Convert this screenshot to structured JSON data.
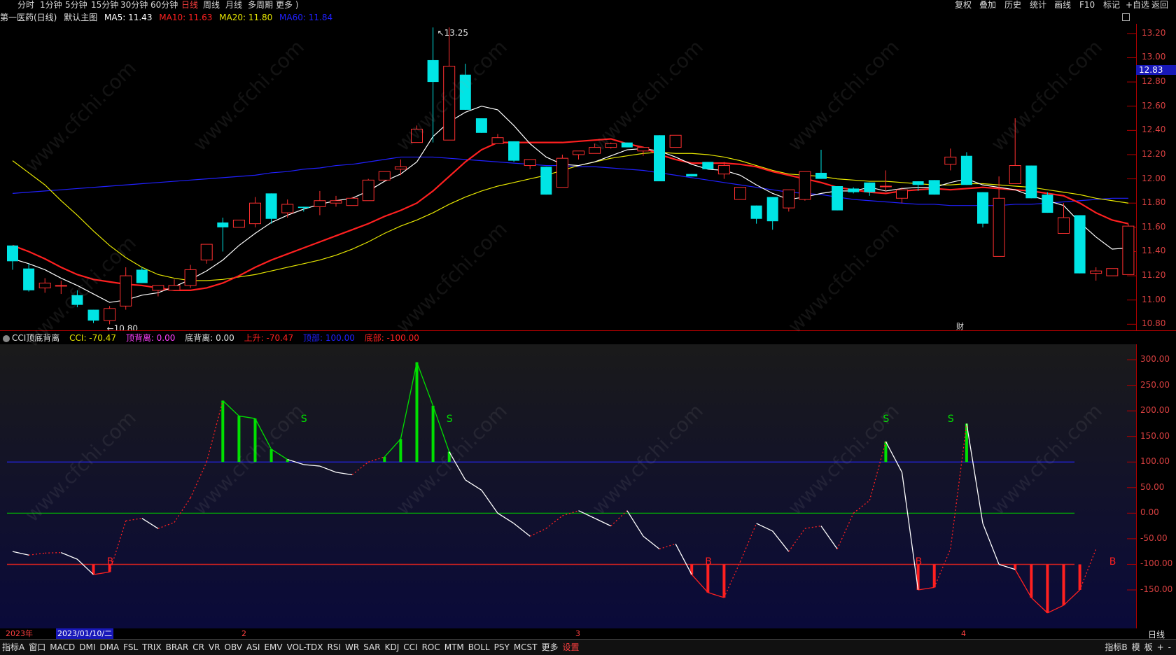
{
  "toolbar_left": [
    "分时",
    "1分钟",
    "5分钟",
    "15分钟",
    "30分钟",
    "60分钟",
    "日线",
    "周线",
    "月线",
    "多周期",
    "更多 )"
  ],
  "toolbar_active": "日线",
  "toolbar_right": [
    "复权",
    "叠加",
    "历史",
    "统计",
    "画线",
    "F10",
    "标记",
    "+自选",
    "返回"
  ],
  "main_info": {
    "stock": "第一医药(日线)",
    "mode": "默认主图",
    "ma5": "MA5: 11.43",
    "ma10": "MA10: 11.63",
    "ma20": "MA20: 11.80",
    "ma60": "MA60: 11.84"
  },
  "price_axis": [
    "13.20",
    "13.00",
    "12.80",
    "12.60",
    "12.40",
    "12.20",
    "12.00",
    "11.80",
    "11.60",
    "11.40",
    "11.20",
    "11.00",
    "10.80"
  ],
  "current_price": "12.83",
  "high_label": "13.25",
  "low_label": "10.80",
  "cai_marker": "财",
  "cci_info": {
    "name": "CCI顶底背离",
    "cci": "CCI: -70.47",
    "top_div": "顶背离: 0.00",
    "bottom_div": "底背离: 0.00",
    "rise": "上升: -70.47",
    "top": "顶部: 100.00",
    "bottom": "底部: -100.00"
  },
  "cci_axis": [
    "300.00",
    "250.00",
    "200.00",
    "150.00",
    "100.00",
    "50.00",
    "0.00",
    "-50.00",
    "-100.00",
    "-150.00"
  ],
  "signals": {
    "sell": "S",
    "buy": "B"
  },
  "dates": {
    "year": "2023年",
    "cursor": "2023/01/10/二",
    "m2": "2",
    "m3": "3",
    "m4": "4"
  },
  "period_label": "日线",
  "bottom_tabs": [
    "指标A",
    "窗口",
    "MACD",
    "DMI",
    "DMA",
    "FSL",
    "TRIX",
    "BRAR",
    "CR",
    "VR",
    "OBV",
    "ASI",
    "EMV",
    "VOL-TDX",
    "RSI",
    "WR",
    "SAR",
    "KDJ",
    "CCI",
    "ROC",
    "MTM",
    "BOLL",
    "PSY",
    "MCST",
    "更多",
    "设置"
  ],
  "bottom_right": [
    "指标B",
    "模",
    "板",
    "+",
    "-"
  ],
  "watermark": "www.cfchi.com",
  "colors": {
    "up": "#ff3030",
    "down": "#00e5e5",
    "ma5": "#ffffff",
    "ma10": "#ff2020",
    "ma20": "#e6e600",
    "ma60": "#2020ff",
    "cci_up": "#00e000",
    "cci_down": "#ff2020"
  },
  "chart_data": {
    "type": "candlestick",
    "ohlc": [
      [
        11.45,
        11.45,
        11.25,
        11.32
      ],
      [
        11.26,
        11.3,
        11.07,
        11.08
      ],
      [
        11.1,
        11.18,
        11.06,
        11.14
      ],
      [
        11.12,
        11.16,
        11.05,
        11.12
      ],
      [
        11.04,
        11.08,
        10.94,
        10.96
      ],
      [
        10.92,
        10.92,
        10.81,
        10.83
      ],
      [
        10.83,
        10.95,
        10.8,
        10.93
      ],
      [
        10.95,
        11.27,
        10.92,
        11.2
      ],
      [
        11.25,
        11.27,
        11.14,
        11.14
      ],
      [
        11.08,
        11.12,
        11.03,
        11.12
      ],
      [
        11.08,
        11.17,
        11.08,
        11.12
      ],
      [
        11.12,
        11.29,
        11.1,
        11.25
      ],
      [
        11.33,
        11.46,
        11.3,
        11.46
      ],
      [
        11.64,
        11.68,
        11.4,
        11.6
      ],
      [
        11.6,
        11.66,
        11.6,
        11.66
      ],
      [
        11.63,
        11.85,
        11.6,
        11.8
      ],
      [
        11.88,
        11.88,
        11.63,
        11.67
      ],
      [
        11.72,
        11.83,
        11.68,
        11.79
      ],
      [
        11.77,
        11.77,
        11.73,
        11.76
      ],
      [
        11.77,
        11.9,
        11.7,
        11.82
      ],
      [
        11.8,
        11.86,
        11.77,
        11.82
      ],
      [
        11.78,
        11.85,
        11.78,
        11.84
      ],
      [
        11.82,
        12.0,
        11.82,
        11.99
      ],
      [
        11.99,
        12.06,
        11.99,
        12.06
      ],
      [
        12.08,
        12.16,
        12.03,
        12.1
      ],
      [
        12.3,
        12.44,
        12.3,
        12.41
      ],
      [
        12.98,
        13.25,
        12.3,
        12.8
      ],
      [
        12.32,
        13.25,
        12.32,
        12.93
      ],
      [
        12.86,
        12.95,
        12.57,
        12.57
      ],
      [
        12.5,
        12.5,
        12.38,
        12.38
      ],
      [
        12.29,
        12.37,
        12.29,
        12.34
      ],
      [
        12.31,
        12.31,
        12.14,
        12.15
      ],
      [
        12.11,
        12.16,
        12.08,
        12.16
      ],
      [
        12.1,
        12.1,
        11.87,
        11.87
      ],
      [
        11.93,
        12.2,
        11.93,
        12.17
      ],
      [
        12.2,
        12.23,
        12.16,
        12.23
      ],
      [
        12.21,
        12.29,
        12.21,
        12.26
      ],
      [
        12.26,
        12.3,
        12.25,
        12.29
      ],
      [
        12.3,
        12.3,
        12.26,
        12.26
      ],
      [
        12.23,
        12.26,
        12.19,
        12.26
      ],
      [
        12.36,
        12.36,
        11.98,
        11.98
      ],
      [
        12.26,
        12.36,
        12.26,
        12.36
      ],
      [
        12.04,
        12.04,
        12.02,
        12.02
      ],
      [
        12.14,
        12.14,
        12.08,
        12.08
      ],
      [
        12.04,
        12.14,
        12.0,
        12.11
      ],
      [
        11.83,
        11.93,
        11.83,
        11.93
      ],
      [
        11.78,
        11.78,
        11.63,
        11.67
      ],
      [
        11.85,
        11.85,
        11.58,
        11.65
      ],
      [
        11.76,
        11.91,
        11.73,
        11.91
      ],
      [
        11.83,
        12.06,
        11.82,
        12.06
      ],
      [
        12.05,
        12.24,
        12.0,
        12.0
      ],
      [
        11.94,
        11.94,
        11.74,
        11.74
      ],
      [
        11.92,
        11.93,
        11.88,
        11.89
      ],
      [
        11.97,
        11.97,
        11.86,
        11.89
      ],
      [
        11.94,
        12.07,
        11.9,
        11.94
      ],
      [
        11.84,
        11.93,
        11.8,
        11.91
      ],
      [
        11.98,
        11.98,
        11.9,
        11.95
      ],
      [
        11.99,
        11.99,
        11.87,
        11.87
      ],
      [
        12.12,
        12.25,
        12.07,
        12.18
      ],
      [
        12.19,
        12.22,
        11.95,
        11.95
      ],
      [
        11.89,
        11.89,
        11.6,
        11.63
      ],
      [
        11.36,
        12.02,
        11.36,
        11.84
      ],
      [
        11.96,
        12.5,
        11.96,
        12.11
      ],
      [
        12.11,
        12.11,
        11.84,
        11.84
      ],
      [
        11.87,
        11.89,
        11.72,
        11.72
      ],
      [
        11.55,
        11.8,
        11.55,
        11.68
      ],
      [
        11.7,
        11.7,
        11.22,
        11.22
      ],
      [
        11.22,
        11.27,
        11.16,
        11.24
      ],
      [
        11.2,
        11.26,
        11.2,
        11.26
      ],
      [
        11.21,
        11.63,
        11.21,
        11.61
      ]
    ],
    "ma5": [
      11.34,
      11.3,
      11.25,
      11.18,
      11.12,
      11.05,
      10.98,
      11.0,
      11.04,
      11.06,
      11.11,
      11.17,
      11.24,
      11.33,
      11.45,
      11.55,
      11.64,
      11.7,
      11.75,
      11.79,
      11.82,
      11.84,
      11.9,
      11.98,
      12.04,
      12.14,
      12.35,
      12.47,
      12.55,
      12.6,
      12.57,
      12.44,
      12.29,
      12.18,
      12.12,
      12.11,
      12.14,
      12.19,
      12.24,
      12.25,
      12.23,
      12.18,
      12.12,
      12.08,
      12.07,
      12.03,
      11.95,
      11.88,
      11.83,
      11.85,
      11.88,
      11.9,
      11.9,
      11.93,
      11.9,
      11.92,
      11.93,
      11.93,
      11.97,
      12.0,
      11.95,
      11.93,
      11.91,
      11.86,
      11.82,
      11.78,
      11.64,
      11.52,
      11.42,
      11.43
    ],
    "ma10": [
      11.45,
      11.4,
      11.34,
      11.27,
      11.21,
      11.17,
      11.15,
      11.13,
      11.12,
      11.1,
      11.08,
      11.08,
      11.1,
      11.14,
      11.2,
      11.27,
      11.33,
      11.38,
      11.43,
      11.48,
      11.53,
      11.58,
      11.63,
      11.69,
      11.74,
      11.8,
      11.9,
      12.02,
      12.14,
      12.24,
      12.3,
      12.3,
      12.3,
      12.3,
      12.3,
      12.31,
      12.32,
      12.33,
      12.29,
      12.26,
      12.2,
      12.16,
      12.13,
      12.13,
      12.13,
      12.12,
      12.1,
      12.06,
      12.03,
      12.0,
      11.97,
      11.93,
      11.91,
      11.89,
      11.88,
      11.9,
      11.91,
      11.92,
      11.91,
      11.92,
      11.93,
      11.92,
      11.91,
      11.9,
      11.88,
      11.86,
      11.8,
      11.72,
      11.66,
      11.63
    ],
    "ma20": [
      12.15,
      12.05,
      11.95,
      11.82,
      11.7,
      11.57,
      11.45,
      11.35,
      11.27,
      11.21,
      11.18,
      11.16,
      11.16,
      11.17,
      11.19,
      11.21,
      11.24,
      11.27,
      11.3,
      11.33,
      11.37,
      11.42,
      11.48,
      11.55,
      11.61,
      11.66,
      11.72,
      11.79,
      11.85,
      11.9,
      11.94,
      11.97,
      12.0,
      12.03,
      12.07,
      12.11,
      12.14,
      12.17,
      12.19,
      12.21,
      12.22,
      12.21,
      12.21,
      12.2,
      12.18,
      12.15,
      12.11,
      12.07,
      12.04,
      12.03,
      12.02,
      12.0,
      11.99,
      11.98,
      11.98,
      11.97,
      11.96,
      11.95,
      11.95,
      11.96,
      11.96,
      11.95,
      11.94,
      11.93,
      11.91,
      11.89,
      11.87,
      11.84,
      11.82,
      11.8
    ],
    "ma60": [
      11.88,
      11.89,
      11.9,
      11.91,
      11.92,
      11.93,
      11.94,
      11.95,
      11.96,
      11.97,
      11.98,
      11.99,
      12.0,
      12.01,
      12.02,
      12.03,
      12.05,
      12.06,
      12.08,
      12.09,
      12.11,
      12.12,
      12.14,
      12.16,
      12.18,
      12.18,
      12.18,
      12.17,
      12.16,
      12.15,
      12.14,
      12.13,
      12.12,
      12.11,
      12.11,
      12.1,
      12.1,
      12.09,
      12.08,
      12.07,
      12.05,
      12.03,
      12.01,
      11.99,
      11.97,
      11.95,
      11.93,
      11.91,
      11.89,
      11.88,
      11.87,
      11.85,
      11.83,
      11.82,
      11.81,
      11.8,
      11.79,
      11.79,
      11.78,
      11.78,
      11.78,
      11.78,
      11.79,
      11.79,
      11.8,
      11.81,
      11.82,
      11.83,
      11.84,
      11.84
    ],
    "cci": [
      -75,
      -82,
      -78,
      -77,
      -90,
      -120,
      -115,
      -15,
      -10,
      -30,
      -18,
      30,
      100,
      220,
      190,
      185,
      125,
      105,
      95,
      92,
      80,
      75,
      100,
      110,
      145,
      295,
      210,
      120,
      65,
      45,
      0,
      -20,
      -45,
      -30,
      -5,
      5,
      -10,
      -25,
      5,
      -45,
      -70,
      -60,
      -120,
      -155,
      -165,
      -95,
      -20,
      -35,
      -75,
      -30,
      -25,
      -70,
      0,
      25,
      140,
      80,
      -150,
      -145,
      -70,
      175,
      -20,
      -100,
      -110,
      -165,
      -195,
      -180,
      -150,
      -70
    ],
    "cci_ylim": [
      -200,
      310
    ],
    "price_ylim": [
      10.75,
      13.28
    ]
  }
}
